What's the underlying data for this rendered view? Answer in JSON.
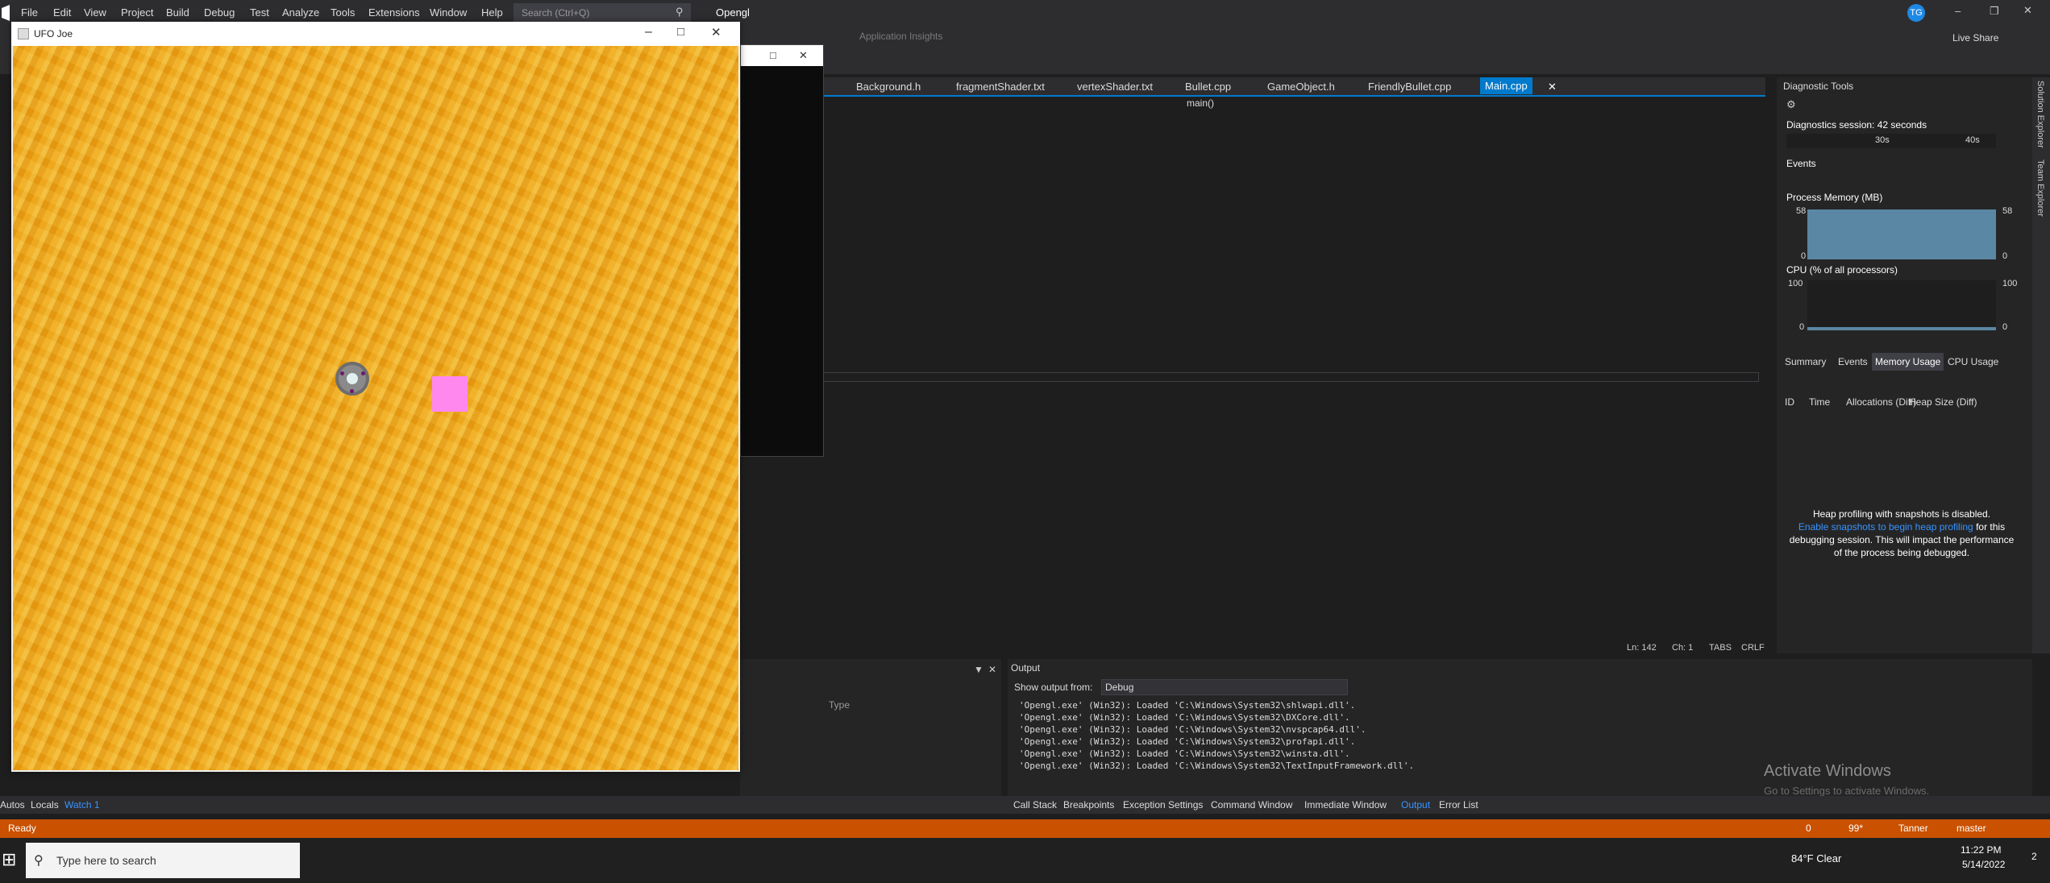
{
  "menubar": {
    "items": [
      "File",
      "Edit",
      "View",
      "Project",
      "Build",
      "Debug",
      "Test",
      "Analyze",
      "Tools",
      "Extensions",
      "Window",
      "Help"
    ],
    "search_placeholder": "Search (Ctrl+Q)",
    "solution_name": "Opengl",
    "account_initials": "TG",
    "live_share_label": "Live Share",
    "app_insights_label": "Application Insights"
  },
  "game_window": {
    "title": "UFO Joe"
  },
  "editor": {
    "tabs": [
      "Background.h",
      "fragmentShader.txt",
      "vertexShader.txt",
      "Bullet.cpp",
      "GameObject.h",
      "FriendlyBullet.cpp",
      "Main.cpp"
    ],
    "active_tab": "Main.cpp",
    "function_nav": "main()",
    "status": {
      "line": "Ln: 142",
      "col": "Ch: 1",
      "tabs": "TABS",
      "eol": "CRLF"
    }
  },
  "diagnostics": {
    "title": "Diagnostic Tools",
    "session": "Diagnostics session: 42 seconds",
    "timeline_ticks": [
      "30s",
      "40s"
    ],
    "events_label": "Events",
    "memory_label": "Process Memory (MB)",
    "memory_max": "58",
    "memory_min": "0",
    "cpu_label": "CPU (% of all processors)",
    "cpu_max": "100",
    "cpu_min": "0",
    "tabs": [
      "Summary",
      "Events",
      "Memory Usage",
      "CPU Usage"
    ],
    "active_tab": "Memory Usage",
    "columns": [
      "ID",
      "Time",
      "Allocations (Diff)",
      "Heap Size (Diff)"
    ],
    "heap_message_1": "Heap profiling with snapshots is disabled.",
    "heap_link": "Enable snapshots to begin heap profiling",
    "heap_message_2": " for this debugging session. This will impact the performance of the process being debugged."
  },
  "watch": {
    "type_header": "Type"
  },
  "output": {
    "title": "Output",
    "show_from_label": "Show output from:",
    "source": "Debug",
    "lines": [
      "'Opengl.exe' (Win32): Loaded 'C:\\Windows\\System32\\shlwapi.dll'.",
      "'Opengl.exe' (Win32): Loaded 'C:\\Windows\\System32\\DXCore.dll'.",
      "'Opengl.exe' (Win32): Loaded 'C:\\Windows\\System32\\nvspcap64.dll'.",
      "'Opengl.exe' (Win32): Loaded 'C:\\Windows\\System32\\profapi.dll'.",
      "'Opengl.exe' (Win32): Loaded 'C:\\Windows\\System32\\winsta.dll'.",
      "'Opengl.exe' (Win32): Loaded 'C:\\Windows\\System32\\TextInputFramework.dll'."
    ],
    "watermark_1": "Activate Windows",
    "watermark_2": "Go to Settings to activate Windows."
  },
  "bottom_tabs_left": [
    "Autos",
    "Locals",
    "Watch 1"
  ],
  "bottom_tabs_right": [
    "Call Stack",
    "Breakpoints",
    "Exception Settings",
    "Command Window",
    "Immediate Window",
    "Output",
    "Error List"
  ],
  "statusbar": {
    "ready": "Ready",
    "errors": "0",
    "changes": "99*",
    "user": "Tanner",
    "branch": "master"
  },
  "taskbar": {
    "search_placeholder": "Type here to search",
    "weather": "84°F  Clear",
    "time": "11:22 PM",
    "date": "5/14/2022",
    "notifications": "2"
  },
  "side_labels": [
    "Solution Explorer",
    "Team Explorer"
  ],
  "colors": {
    "accent": "#007acc",
    "statusbar": "#ca5100",
    "player": "#ff88ee",
    "ufo": "#808080"
  }
}
